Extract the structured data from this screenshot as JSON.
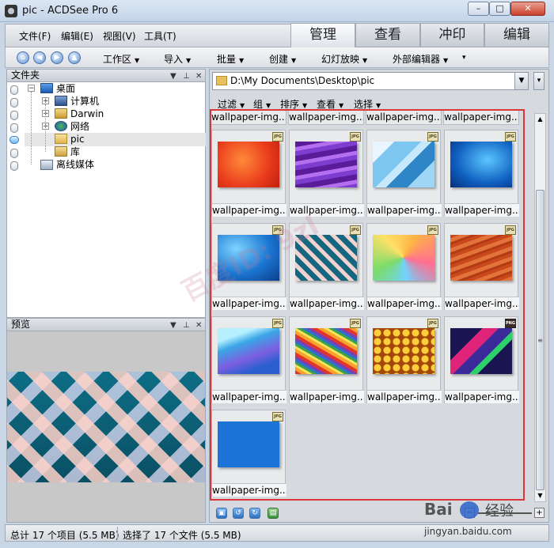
{
  "window": {
    "title": "pic - ACDSee Pro 6",
    "minimize_label": "–",
    "maximize_label": "□",
    "close_label": "✕"
  },
  "menu": [
    "文件(F)",
    "编辑(E)",
    "视图(V)",
    "工具(T)"
  ],
  "mode_tabs": [
    "管理",
    "查看",
    "冲印",
    "编辑"
  ],
  "toolbar": {
    "items": [
      "工作区",
      "导入",
      "批量",
      "创建",
      "幻灯放映",
      "外部编辑器"
    ],
    "more_label": "▾"
  },
  "folders_panel": {
    "title": "文件夹",
    "tree": [
      {
        "label": "桌面",
        "icon": "desktop-icon"
      },
      {
        "label": "计算机",
        "icon": "computer-icon"
      },
      {
        "label": "Darwin",
        "icon": "user-folder-icon"
      },
      {
        "label": "网络",
        "icon": "network-icon"
      },
      {
        "label": "pic",
        "icon": "folder-icon"
      },
      {
        "label": "库",
        "icon": "library-icon"
      },
      {
        "label": "离线媒体",
        "icon": "offline-media-icon"
      }
    ]
  },
  "preview_panel": {
    "title": "预览"
  },
  "path_bar": {
    "value": "D:\\My Documents\\Desktop\\pic"
  },
  "filter_bar": [
    "过滤",
    "组",
    "排序",
    "查看",
    "选择"
  ],
  "thumbnails": {
    "top_captions": [
      "wallpaper-img...",
      "wallpaper-img...",
      "wallpaper-img...",
      "wallpaper-img..."
    ],
    "items": [
      {
        "caption": "wallpaper-img...",
        "format": "JPG",
        "swatch": "orange-abstract"
      },
      {
        "caption": "wallpaper-img...",
        "format": "JPG",
        "swatch": "purple-waves"
      },
      {
        "caption": "wallpaper-img...",
        "format": "JPG",
        "swatch": "light-blue-lines"
      },
      {
        "caption": "wallpaper-img...",
        "format": "JPG",
        "swatch": "blue-windows"
      },
      {
        "caption": "wallpaper-img...",
        "format": "JPG",
        "swatch": "blue-gradient"
      },
      {
        "caption": "wallpaper-img...",
        "format": "JPG",
        "swatch": "teal-diagonal-stripes"
      },
      {
        "caption": "wallpaper-img...",
        "format": "JPG",
        "swatch": "rainbow-blur"
      },
      {
        "caption": "wallpaper-img...",
        "format": "JPG",
        "swatch": "orange-wood"
      },
      {
        "caption": "wallpaper-img...",
        "format": "JPG",
        "swatch": "blue-wave"
      },
      {
        "caption": "wallpaper-img...",
        "format": "JPG",
        "swatch": "rainbow-curves"
      },
      {
        "caption": "wallpaper-img...",
        "format": "JPG",
        "swatch": "honeycomb"
      },
      {
        "caption": "wallpaper-img...",
        "format": "PNG",
        "swatch": "geometric-purple"
      },
      {
        "caption": "wallpaper-img...",
        "format": "JPG",
        "swatch": "solid-blue"
      }
    ]
  },
  "status": {
    "total": "总计 17 个项目 (5.5 MB)",
    "selected": "选择了 17 个文件 (5.5 MB)"
  },
  "watermark": {
    "diagonal": "百度ID: 9zl",
    "brand": "Bai",
    "jingyan": "经验",
    "url": "jingyan.baidu.com"
  },
  "colors": {
    "highlight_border": "#d9383a",
    "selected_row": "#e6e6e6"
  }
}
